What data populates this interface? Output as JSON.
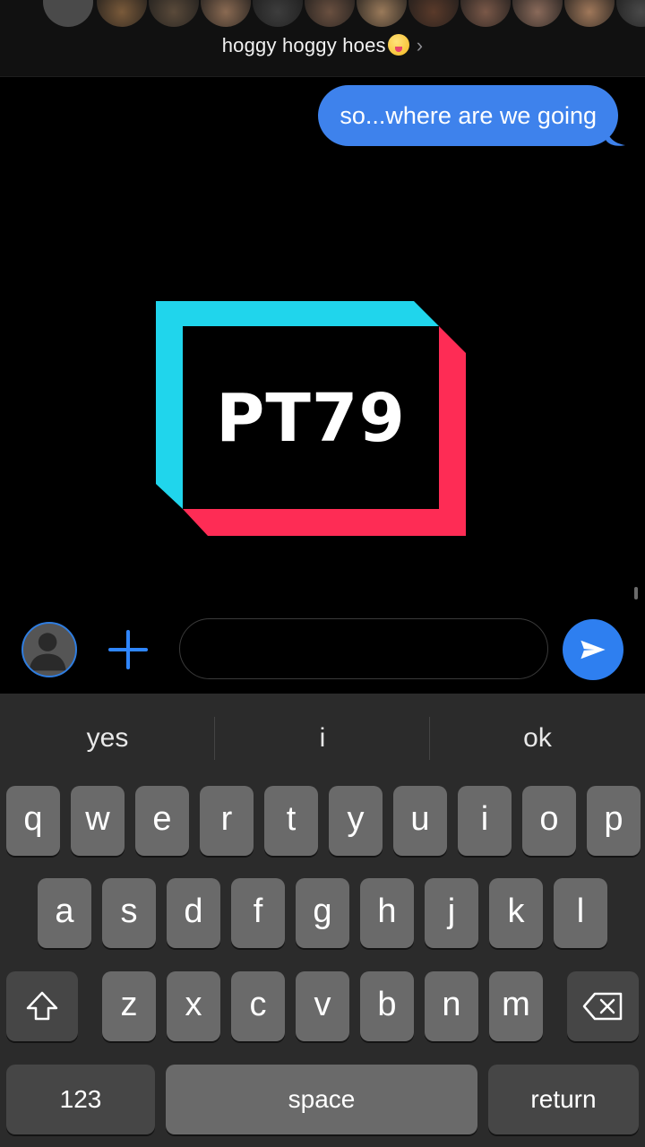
{
  "header": {
    "group_name": "hoggy hoggy hoes",
    "chevron": "›",
    "emoji_icon": "zany-face-emoji",
    "member_avatar_colors": [
      "#3a3a3a",
      "#7a5a3a",
      "#5a4a3a",
      "#8a6a52",
      "#3d3d3d",
      "#6a5040",
      "#9a7a5a",
      "#5a3a2a",
      "#7a5848",
      "#8a6a5a",
      "#a0785a",
      "#4a4a4a"
    ]
  },
  "message": {
    "text": "so...where are we going",
    "color": "#3e82ec"
  },
  "logo": {
    "text": "PT79",
    "cyan": "#20d5ec",
    "pink": "#fe2c55"
  },
  "composer": {
    "avatar_icon": "person-icon",
    "plus_icon": "plus-icon",
    "input_value": "",
    "input_placeholder": "",
    "send_icon": "paper-plane-icon",
    "accent": "#2e7ff0"
  },
  "keyboard": {
    "suggestions": [
      "yes",
      "i",
      "ok"
    ],
    "row1": [
      "q",
      "w",
      "e",
      "r",
      "t",
      "y",
      "u",
      "i",
      "o",
      "p"
    ],
    "row2": [
      "a",
      "s",
      "d",
      "f",
      "g",
      "h",
      "j",
      "k",
      "l"
    ],
    "row3": [
      "z",
      "x",
      "c",
      "v",
      "b",
      "n",
      "m"
    ],
    "shift_icon": "shift-icon",
    "backspace_icon": "backspace-icon",
    "numbers_label": "123",
    "space_label": "space",
    "return_label": "return"
  }
}
